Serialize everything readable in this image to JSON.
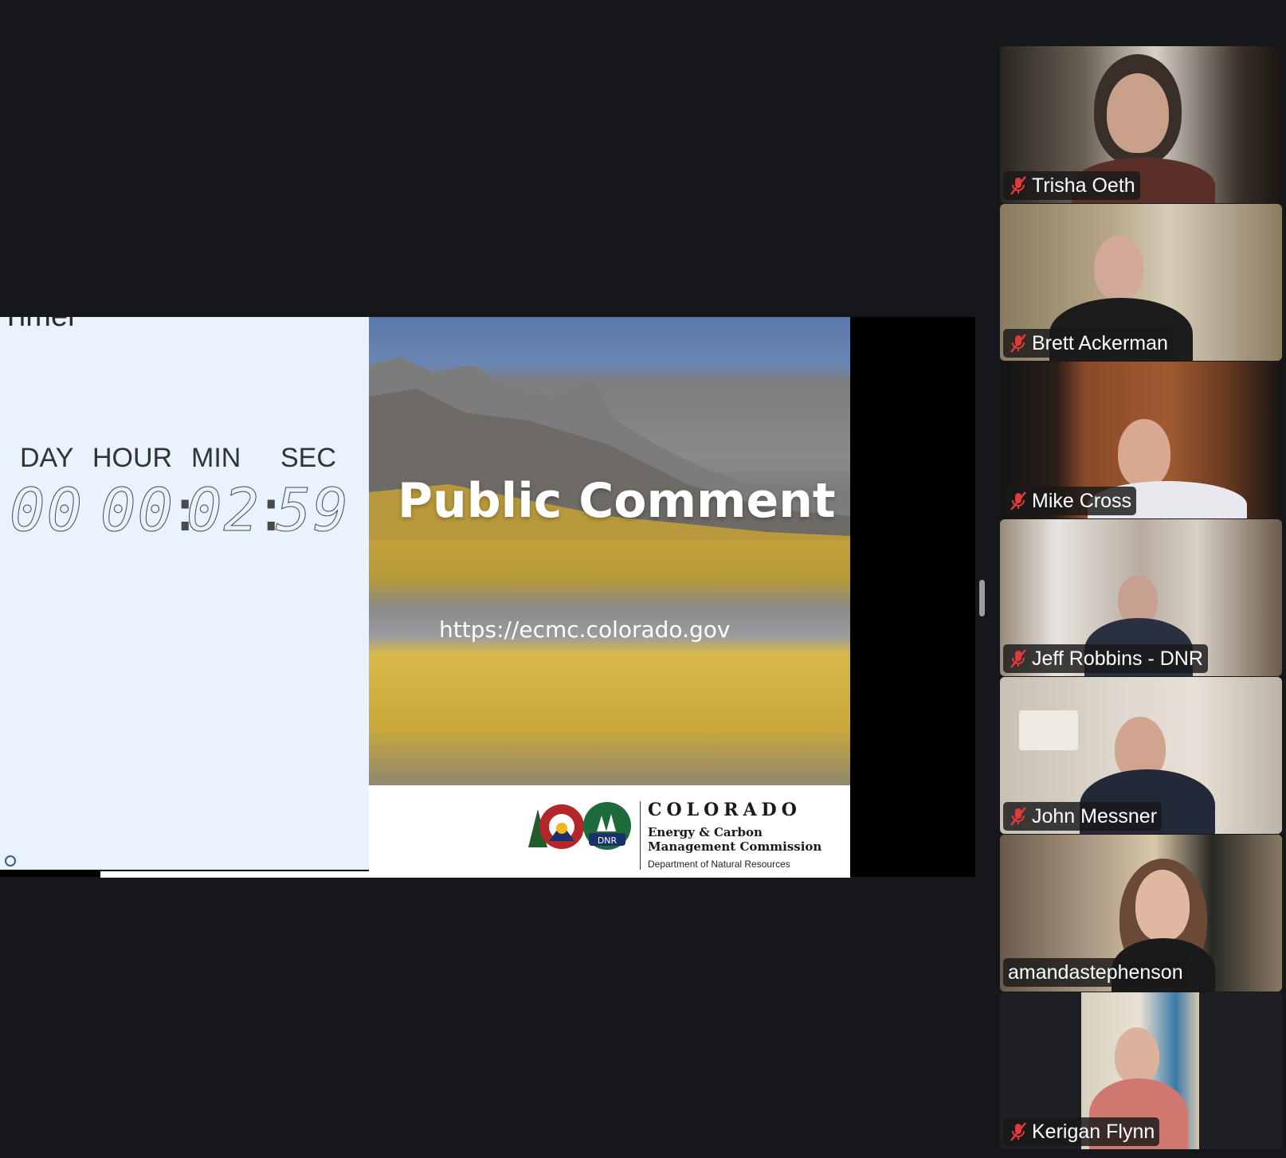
{
  "timer": {
    "title": "Timer",
    "labels": {
      "day": "DAY",
      "hour": "HOUR",
      "min": "MIN",
      "sec": "SEC"
    },
    "values": {
      "day": "00",
      "hour": "00",
      "min": "02",
      "sec": "59"
    },
    "separator": ":"
  },
  "slide": {
    "title": "Public Comment",
    "url": "https://ecmc.colorado.gov",
    "org_name": "COLORADO",
    "org_line2": "Energy & Carbon Management Commission",
    "org_line3": "Department of Natural Resources",
    "dnr_badge": "DNR"
  },
  "participants": [
    {
      "name": "Trisha Oeth",
      "muted": true,
      "active": false
    },
    {
      "name": "Brett Ackerman",
      "muted": true,
      "active": false
    },
    {
      "name": "Mike Cross",
      "muted": true,
      "active": false
    },
    {
      "name": "Jeff Robbins - DNR",
      "muted": true,
      "active": false
    },
    {
      "name": "John Messner",
      "muted": true,
      "active": false
    },
    {
      "name": "amandastephenson",
      "muted": false,
      "active": true
    },
    {
      "name": "Kerigan Flynn",
      "muted": true,
      "active": false
    }
  ],
  "colors": {
    "background": "#15171b",
    "active_speaker": "#3dd43a",
    "muted_mic": "#e03a3a"
  }
}
